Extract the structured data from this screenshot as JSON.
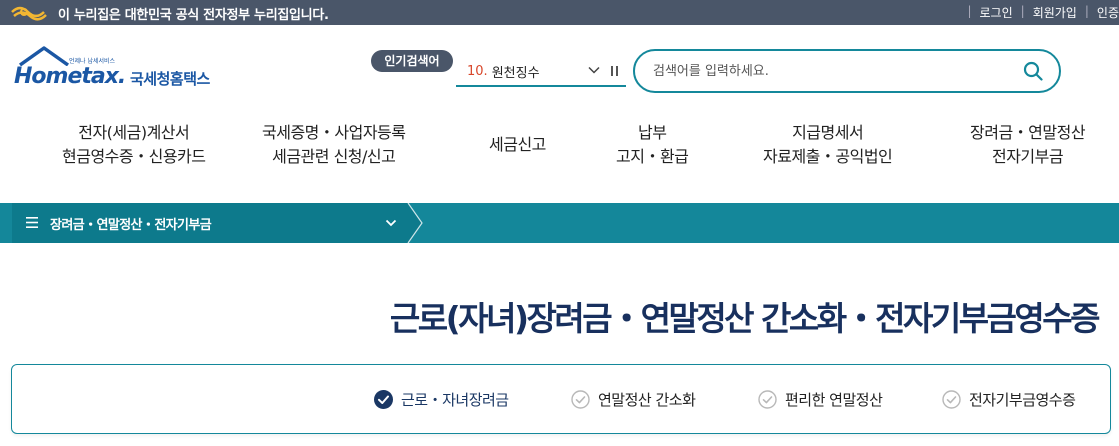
{
  "gov_bar": {
    "notice": "이 누리집은 대한민국 공식 전자정부 누리집입니다.",
    "links": [
      "로그인",
      "회원가입",
      "인증"
    ]
  },
  "logo": {
    "sub": "언제나 납세서비스",
    "brand": "Hometax.",
    "name": "국세청홈택스"
  },
  "popular": {
    "badge": "인기검색어",
    "rank": "10.",
    "word": "원천징수"
  },
  "search": {
    "placeholder": "검색어를 입력하세요."
  },
  "nav": [
    {
      "line1": "전자(세금)계산서",
      "line2": "현금영수증・신용카드"
    },
    {
      "line1": "국세증명・사업자등록",
      "line2": "세금관련 신청/신고"
    },
    {
      "line1": "세금신고",
      "line2": ""
    },
    {
      "line1": "납부",
      "line2": "고지・환급"
    },
    {
      "line1": "지급명세서",
      "line2": "자료제출・공익법인"
    },
    {
      "line1": "장려금・연말정산",
      "line2": "전자기부금"
    }
  ],
  "subbar": {
    "title": "장려금・연말정산・전자기부금"
  },
  "page": {
    "title": "근로(자녀)장려금・연말정산 간소화・전자기부금영수증"
  },
  "tabs": [
    {
      "label": "근로・자녀장려금",
      "active": true
    },
    {
      "label": "연말정산 간소화",
      "active": false
    },
    {
      "label": "편리한 연말정산",
      "active": false
    },
    {
      "label": "전자기부금영수증",
      "active": false
    }
  ],
  "colors": {
    "teal": "#14879a",
    "navy": "#18305e",
    "gov_bar": "#4a5669",
    "rank_red": "#d8472b"
  }
}
